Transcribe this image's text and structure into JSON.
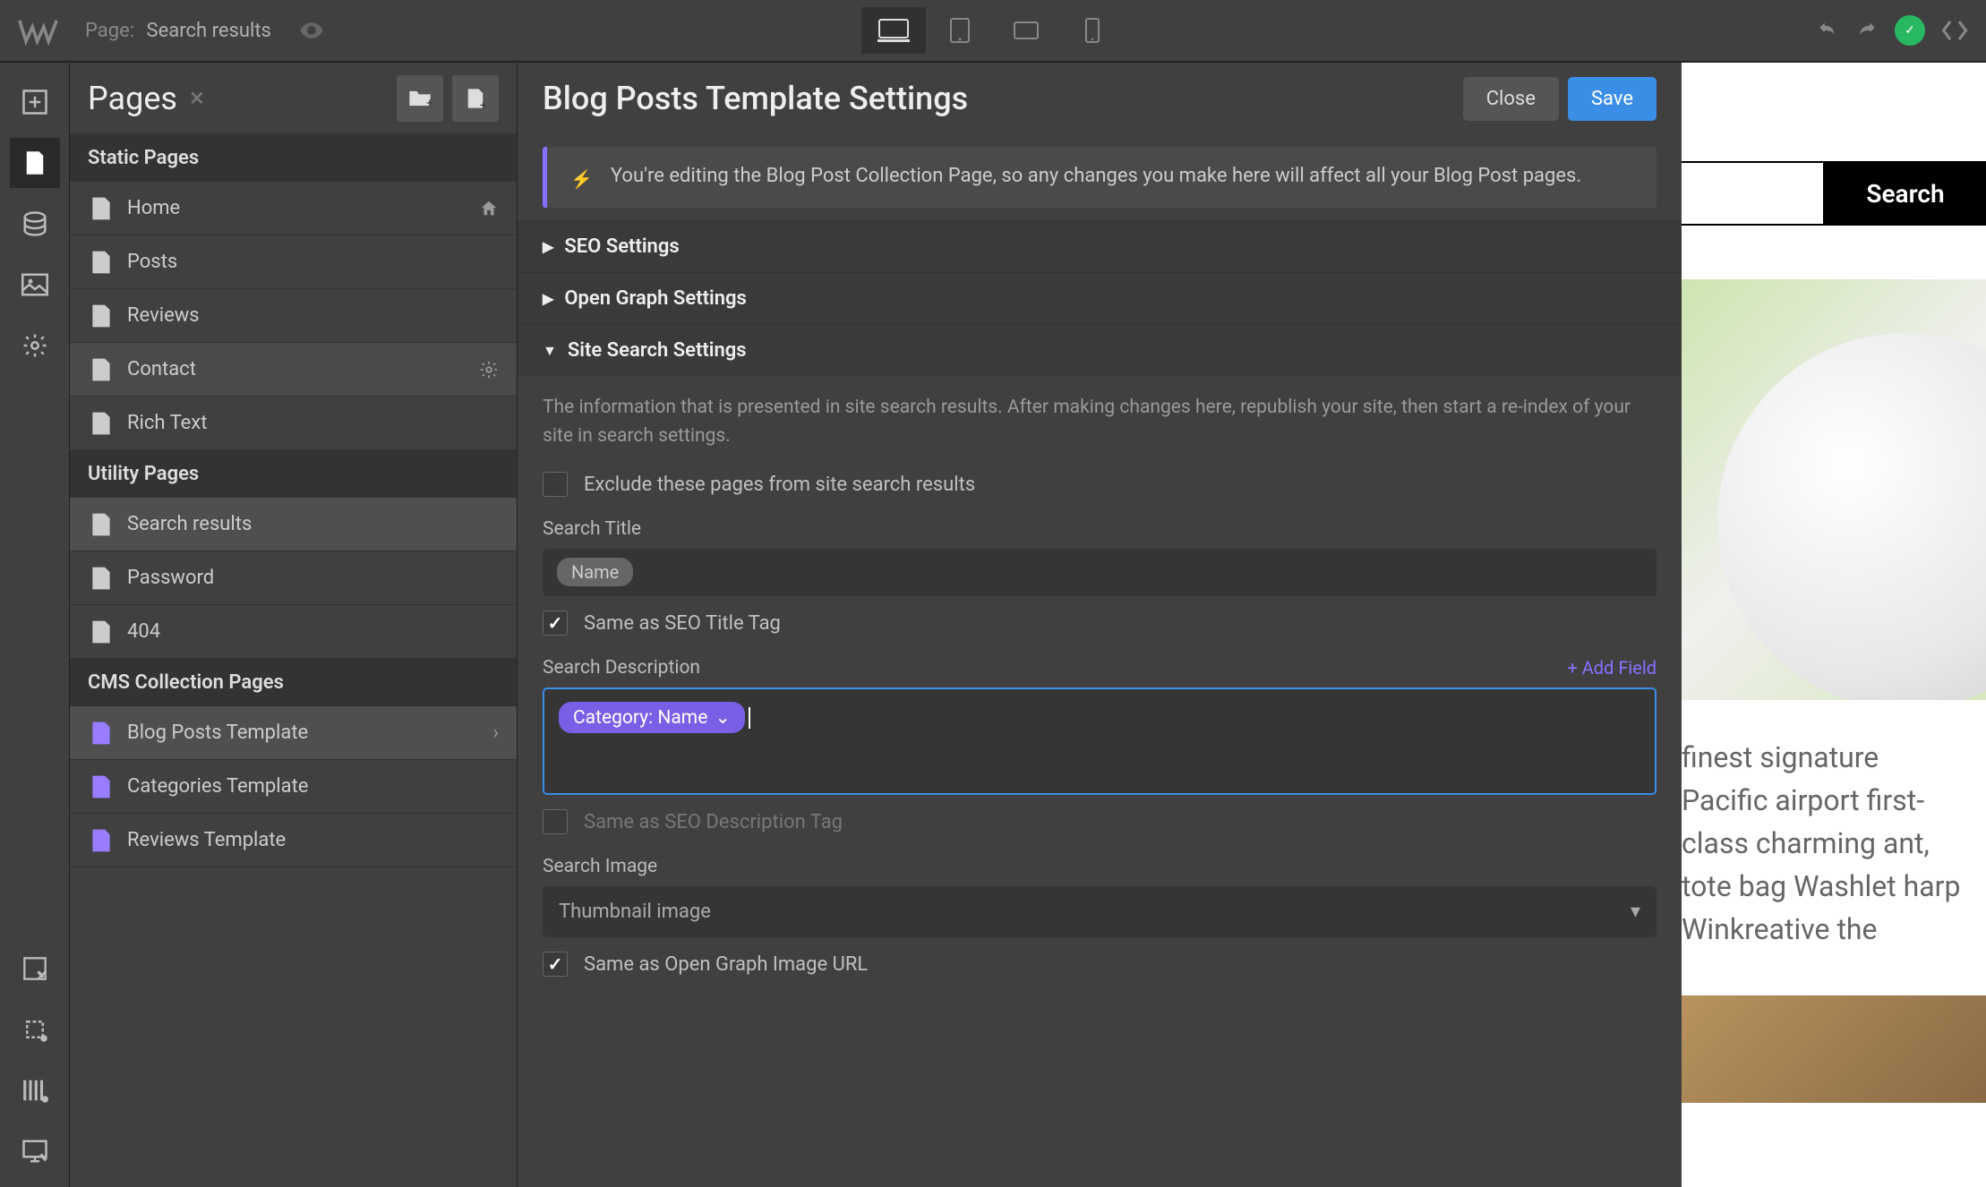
{
  "topbar": {
    "page_label": "Page:",
    "page_value": "Search results"
  },
  "pages_panel": {
    "title": "Pages",
    "sections": {
      "static": "Static Pages",
      "utility": "Utility Pages",
      "cms": "CMS Collection Pages"
    },
    "static_items": [
      "Home",
      "Posts",
      "Reviews",
      "Contact",
      "Rich Text"
    ],
    "utility_items": [
      "Search results",
      "Password",
      "404"
    ],
    "cms_items": [
      "Blog Posts Template",
      "Categories Template",
      "Reviews Template"
    ]
  },
  "settings": {
    "title": "Blog Posts Template Settings",
    "close_label": "Close",
    "save_label": "Save",
    "banner": "You're editing the Blog Post Collection Page, so any changes you make here will affect all your Blog Post pages.",
    "seo_heading": "SEO Settings",
    "og_heading": "Open Graph Settings",
    "search_heading": "Site Search Settings",
    "search_help": "The information that is presented in site search results. After making changes here, republish your site, then start a re-index of your site in search settings.",
    "exclude_label": "Exclude these pages from site search results",
    "search_title_label": "Search Title",
    "search_title_value": "Name",
    "same_seo_title": "Same as SEO Title Tag",
    "search_desc_label": "Search Description",
    "add_field": "+ Add Field",
    "desc_pill": "Category: Name",
    "same_seo_desc": "Same as SEO Description Tag",
    "search_image_label": "Search Image",
    "search_image_value": "Thumbnail image",
    "same_og_image": "Same as Open Graph Image URL"
  },
  "preview": {
    "search_btn": "Search",
    "body_text": "finest signature Pacific airport first-class charming ant, tote bag Washlet harp Winkreative the"
  }
}
